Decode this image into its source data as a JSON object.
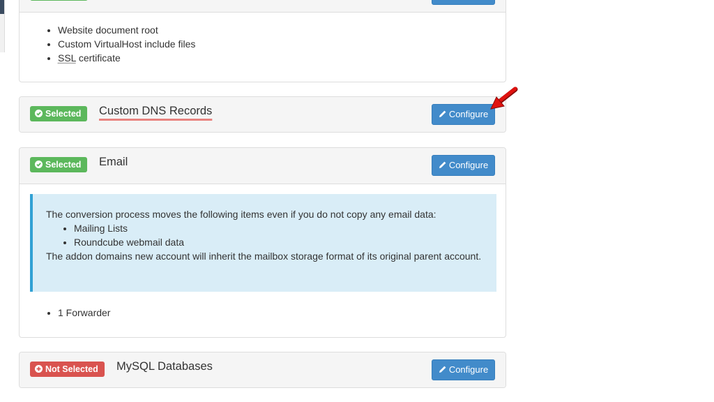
{
  "panels": {
    "docroot": {
      "items": [
        "Website document root",
        "Custom VirtualHost include files"
      ],
      "ssl_abbr": "SSL",
      "ssl_rest": " certificate"
    },
    "dns": {
      "badge": "Selected",
      "title": "Custom DNS Records",
      "button": "Configure"
    },
    "email": {
      "badge": "Selected",
      "title": "Email",
      "button": "Configure",
      "info_intro": "The conversion process moves the following items even if you do not copy any email data:",
      "info_items": [
        "Mailing Lists",
        "Roundcube webmail data"
      ],
      "info_outro": "The addon domains new account will inherit the mailbox storage format of its original parent account.",
      "items": [
        "1 Forwarder"
      ]
    },
    "mysql": {
      "badge": "Not Selected",
      "title": "MySQL Databases",
      "button": "Configure"
    }
  },
  "colors": {
    "selected": "#5cb85c",
    "not_selected": "#d9534f",
    "button": "#428bca",
    "info_bg": "#d9edf7",
    "info_border": "#31a1d4",
    "arrow": "#e0120f"
  },
  "icons": {
    "selected": "check-circle-icon",
    "not_selected": "plus-circle-icon",
    "configure": "pencil-icon"
  }
}
